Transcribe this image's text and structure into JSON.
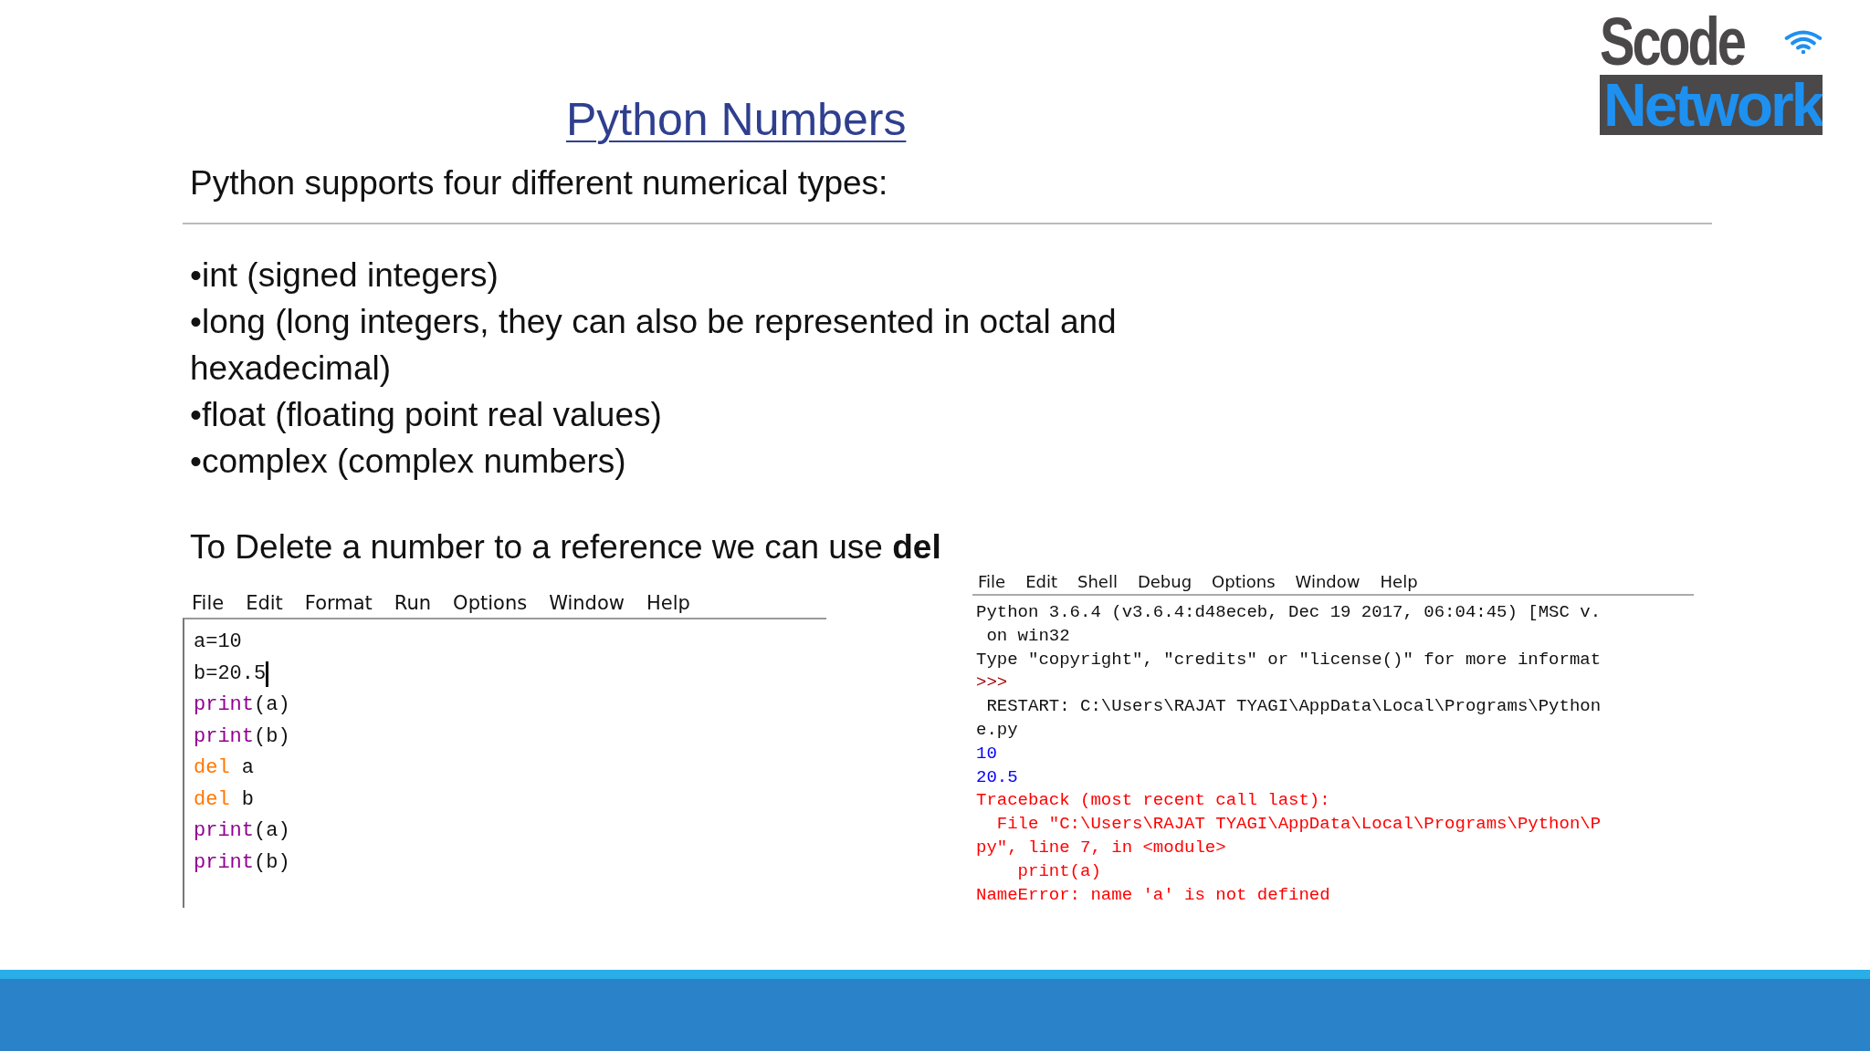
{
  "title": "Python Numbers",
  "logo": {
    "top": "Scode",
    "bottom": "Network"
  },
  "intro": "Python supports four different numerical types:",
  "bullets": [
    "•int (signed integers)",
    "•long (long integers, they can also be represented in octal and hexadecimal)",
    "•float (floating point real values)",
    "•complex (complex numbers)"
  ],
  "note": "To Delete a number to a reference we can use **del**",
  "editor": {
    "menu": [
      "File",
      "Edit",
      "Format",
      "Run",
      "Options",
      "Window",
      "Help"
    ],
    "lines": [
      {
        "cursor": false,
        "parts": [
          {
            "text": "a=10",
            "kind": "plain"
          }
        ]
      },
      {
        "cursor": true,
        "parts": [
          {
            "text": "b=20.5",
            "kind": "plain"
          }
        ]
      },
      {
        "cursor": false,
        "parts": [
          {
            "text": "print",
            "kind": "builtin"
          },
          {
            "text": "(a)",
            "kind": "plain"
          }
        ]
      },
      {
        "cursor": false,
        "parts": [
          {
            "text": "print",
            "kind": "builtin"
          },
          {
            "text": "(b)",
            "kind": "plain"
          }
        ]
      },
      {
        "cursor": false,
        "parts": [
          {
            "text": "del",
            "kind": "keyword"
          },
          {
            "text": " a",
            "kind": "plain"
          }
        ]
      },
      {
        "cursor": false,
        "parts": [
          {
            "text": "del",
            "kind": "keyword"
          },
          {
            "text": " b",
            "kind": "plain"
          }
        ]
      },
      {
        "cursor": false,
        "parts": [
          {
            "text": "print",
            "kind": "builtin"
          },
          {
            "text": "(a)",
            "kind": "plain"
          }
        ]
      },
      {
        "cursor": false,
        "parts": [
          {
            "text": "print",
            "kind": "builtin"
          },
          {
            "text": "(b)",
            "kind": "plain"
          }
        ]
      }
    ]
  },
  "shell": {
    "menu": [
      "File",
      "Edit",
      "Shell",
      "Debug",
      "Options",
      "Window",
      "Help"
    ],
    "lines": [
      {
        "text": "Python 3.6.4 (v3.6.4:d48eceb, Dec 19 2017, 06:04:45) [MSC v.",
        "kind": "plain"
      },
      {
        "text": " on win32",
        "kind": "plain"
      },
      {
        "text": "Type \"copyright\", \"credits\" or \"license()\" for more informat",
        "kind": "plain"
      },
      {
        "text": ">>>",
        "kind": "prompt"
      },
      {
        "text": " RESTART: C:\\Users\\RAJAT TYAGI\\AppData\\Local\\Programs\\Python",
        "kind": "plain"
      },
      {
        "text": "e.py",
        "kind": "plain"
      },
      {
        "text": "10",
        "kind": "output"
      },
      {
        "text": "20.5",
        "kind": "output"
      },
      {
        "text": "Traceback (most recent call last):",
        "kind": "error"
      },
      {
        "text": "  File \"C:\\Users\\RAJAT TYAGI\\AppData\\Local\\Programs\\Python\\P",
        "kind": "error"
      },
      {
        "text": "py\", line 7, in <module>",
        "kind": "error"
      },
      {
        "text": "    print(a)",
        "kind": "error"
      },
      {
        "text": "NameError: name 'a' is not defined",
        "kind": "error"
      }
    ]
  }
}
